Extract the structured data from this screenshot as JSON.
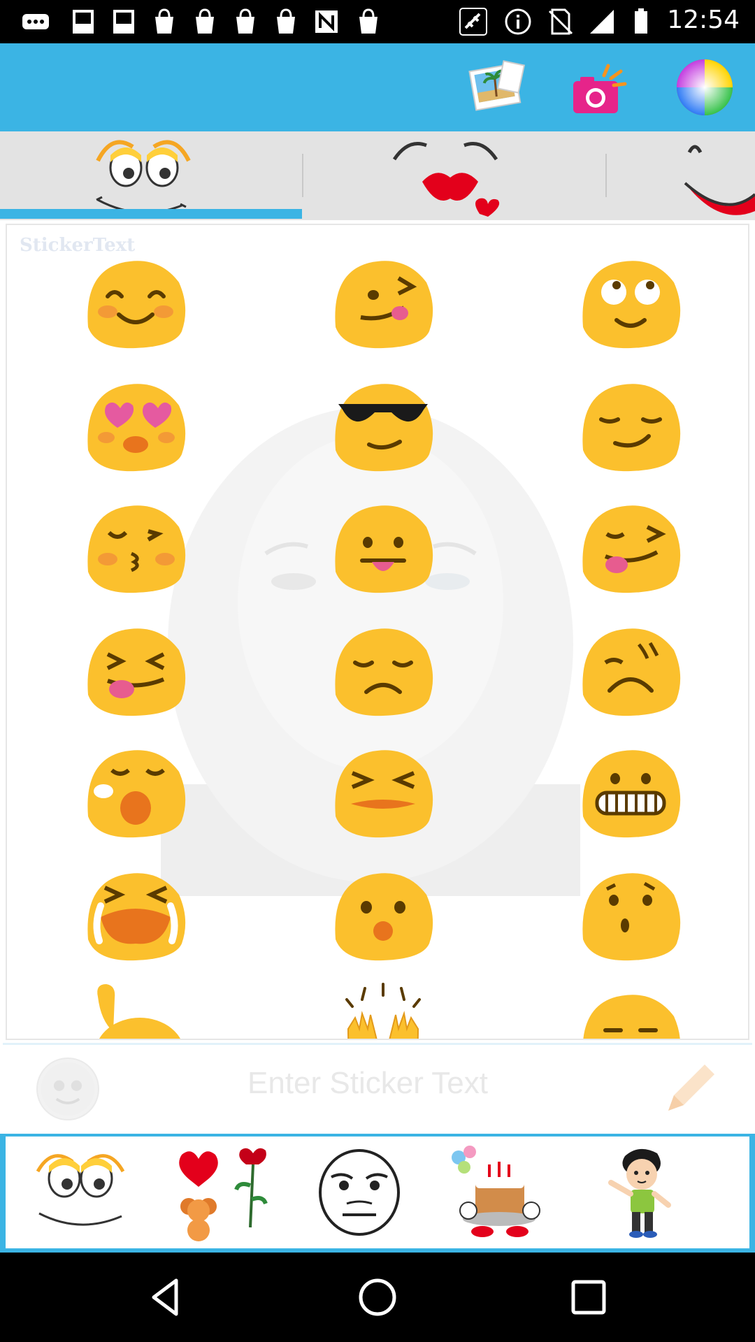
{
  "status_bar": {
    "time": "12:54",
    "icons": [
      "more-icon",
      "gallery-icon",
      "gallery-icon",
      "shopping-icon",
      "news-icon",
      "fake-gps-icon",
      "satellite-icon",
      "info-icon",
      "no-sim-icon",
      "signal-icon",
      "battery-icon"
    ]
  },
  "toolbar": {
    "buttons": [
      "photos-icon",
      "camera-icon",
      "color-wheel-icon"
    ]
  },
  "tabs": {
    "items": [
      "eyes-smile-face-tab",
      "kiss-lips-face-tab",
      "big-smile-face-tab"
    ],
    "selected_index": 0
  },
  "canvas": {
    "watermark": "StickerText"
  },
  "emoji_grid": {
    "items": [
      "smiling-blush-emoji",
      "wink-tongue-emoji",
      "rolling-eyes-emoji",
      "heart-eyes-emoji",
      "sunglasses-emoji",
      "smirk-emoji",
      "kissing-closed-eyes-emoji",
      "tongue-out-emoji",
      "wink-tongue-squint-emoji",
      "squint-tongue-emoji",
      "sad-emoji",
      "worried-emoji",
      "sleepy-yawn-emoji",
      "persevere-emoji",
      "grimace-emoji",
      "crying-loud-emoji",
      "surprised-emoji",
      "hushed-emoji",
      "flexed-biceps-emoji",
      "raised-hands-emoji",
      "unamused-emoji"
    ]
  },
  "text_bar": {
    "placeholder": "Enter Sticker Text"
  },
  "bottom_categories": {
    "items": [
      "face-category",
      "love-category",
      "rage-face-category",
      "birthday-category",
      "cartoon-boy-category"
    ]
  },
  "colors": {
    "accent": "#3bb4e4",
    "emoji_yellow": "#fbc02d",
    "tab_bg": "#e3e3e3"
  }
}
